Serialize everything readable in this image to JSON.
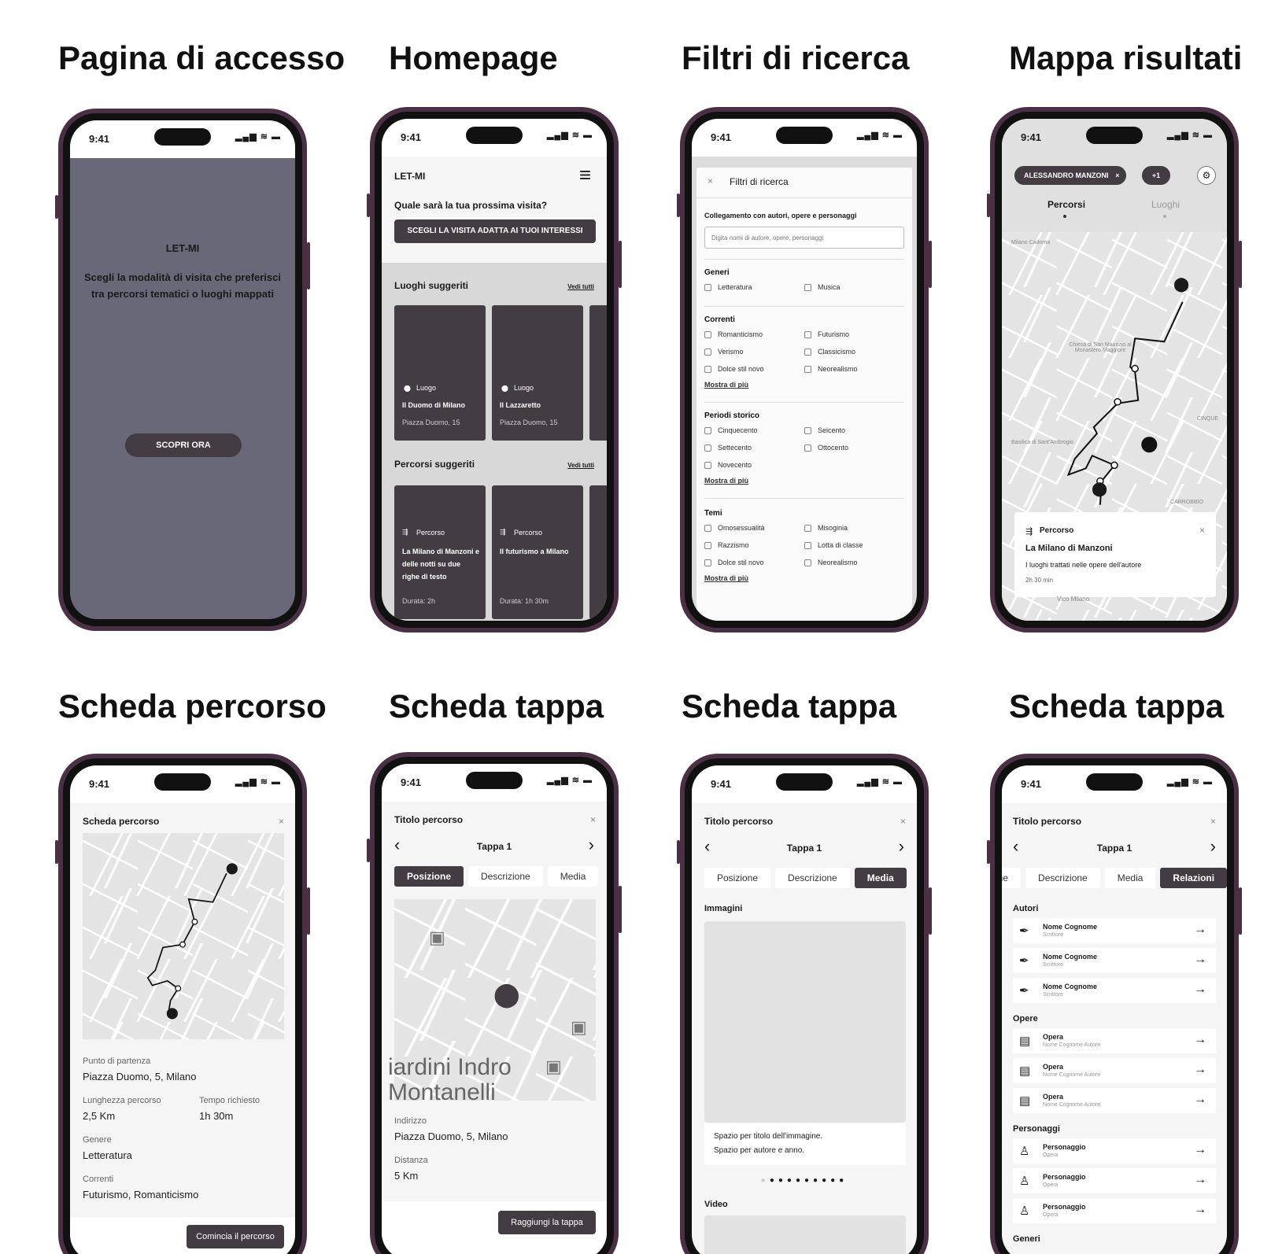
{
  "titles": {
    "t1": "Pagina di accesso",
    "t2": "Homepage",
    "t3": "Filtri di ricerca",
    "t4": "Mappa risultati",
    "t5": "Scheda percorso",
    "t6": "Scheda tappa",
    "t7": "Scheda tappa",
    "t8": "Scheda tappa"
  },
  "status": {
    "time": "9:41",
    "icons": "▂▄▆ ≋ ▬"
  },
  "login": {
    "app_name": "LET-MI",
    "tagline": "Scegli la modalità di visita che preferisci tra percorsi tematici o luoghi mappati",
    "cta": "SCOPRI ORA",
    "bg_color": "#696879"
  },
  "home": {
    "app_name": "LET-MI",
    "question": "Quale sarà la tua prossima visita?",
    "cta": "SCEGLI LA VISITA ADATTA AI TUOI INTERESSI",
    "places_title": "Luoghi suggeriti",
    "see_all": "Vedi tutti",
    "places": [
      {
        "type": "Luogo",
        "name": "Il Duomo di Milano",
        "address": "Piazza Duomo, 15"
      },
      {
        "type": "Luogo",
        "name": "Il Lazzaretto",
        "address": "Piazza Duomo, 15"
      }
    ],
    "routes_title": "Percorsi suggeriti",
    "routes": [
      {
        "type": "Percorso",
        "name": "La Milano di Manzoni e delle notti su due righe di testo",
        "duration": "Durata: 2h"
      },
      {
        "type": "Percorso",
        "name": "Il futurismo a Milano",
        "duration": "Durata: 1h 30m"
      }
    ]
  },
  "filters": {
    "header": "Filtri di ricerca",
    "link_title": "Collegamento con autori, opere e personaggi",
    "link_placeholder": "Digita nomi di autore, opere, personaggi",
    "more": "Mostra di più",
    "genres": {
      "title": "Generi",
      "items": [
        "Letteratura",
        "Musica"
      ]
    },
    "currents": {
      "title": "Correnti",
      "items": [
        "Romanticismo",
        "Futurismo",
        "Verismo",
        "Classicismo",
        "Dolce stil novo",
        "Neorealismo"
      ]
    },
    "periods": {
      "title": "Periodi storico",
      "items": [
        "Cinquecento",
        "Seicento",
        "Settecento",
        "Ottocento",
        "Novecento"
      ]
    },
    "themes": {
      "title": "Temi",
      "items": [
        "Omosessualità",
        "Misoginia",
        "Razzismo",
        "Lotta di classe",
        "Dolce stil novo",
        "Neorealismo"
      ]
    }
  },
  "results": {
    "chip": "ALESSANDRO MANZONI",
    "chip_more": "+1",
    "tab_routes": "Percorsi",
    "tab_places": "Luoghi",
    "map_labels": {
      "a": "Milano Cadorna",
      "b": "Chiesa di San Maurizio al Monastero Maggiore",
      "c": "Basilica di Sant'Ambrogio",
      "d": "CARROBBIO",
      "e": "CINQUE",
      "f": "Vico Milano"
    },
    "card": {
      "type": "Percorso",
      "name": "La Milano di Manzoni",
      "desc": "I luoghi trattati nelle opere dell'autore",
      "duration": "2h 30 min"
    }
  },
  "route_card": {
    "header": "Scheda percorso",
    "start_label": "Punto di partenza",
    "start_value": "Piazza Duomo, 5, Milano",
    "length_label": "Lunghezza percorso",
    "length_value": "2,5 Km",
    "time_label": "Tempo richiesto",
    "time_value": "1h 30m",
    "genre_label": "Genere",
    "genre_value": "Letteratura",
    "currents_label": "Correnti",
    "currents_value": "Futurismo, Romanticismo",
    "cta": "Comincia il percorso"
  },
  "stop": {
    "title": "Titolo percorso",
    "stop_name": "Tappa 1",
    "tabs": [
      "Posizione",
      "Descrizione",
      "Media",
      "Relazioni"
    ],
    "map_label": "iardini Indro Montanelli",
    "address_label": "Indirizzo",
    "address_value": "Piazza Duomo, 5, Milano",
    "distance_label": "Distanza",
    "distance_value": "5 Km",
    "cta": "Raggiungi la tappa"
  },
  "media": {
    "images_title": "Immagini",
    "caption1": "Spazio per titolo dell'immagine.",
    "caption2": "Spazio per autore e anno.",
    "video_title": "Video"
  },
  "relations": {
    "authors_title": "Autori",
    "authors": [
      {
        "name": "Nome Cognome",
        "sub": "Scrittore"
      },
      {
        "name": "Nome Cognome",
        "sub": "Scrittore"
      },
      {
        "name": "Nome Cognome",
        "sub": "Scrittore"
      }
    ],
    "works_title": "Opere",
    "works": [
      {
        "name": "Opera",
        "sub": "Nome Cognome Autore"
      },
      {
        "name": "Opera",
        "sub": "Nome Cognome Autore"
      },
      {
        "name": "Opera",
        "sub": "Nome Cognome Autore"
      }
    ],
    "characters_title": "Personaggi",
    "characters": [
      {
        "name": "Personaggio",
        "sub": "Opera"
      },
      {
        "name": "Personaggio",
        "sub": "Opera"
      },
      {
        "name": "Personaggio",
        "sub": "Opera"
      }
    ],
    "genres_title": "Generi"
  },
  "icons": {
    "close": "×",
    "prev": "‹",
    "next": "›",
    "arrow": "→",
    "pin": "⬤",
    "menu": "≡",
    "route": "⇶",
    "filter": "⚙",
    "quill": "✒",
    "book": "▤",
    "person": "♙",
    "bus": "▣"
  }
}
